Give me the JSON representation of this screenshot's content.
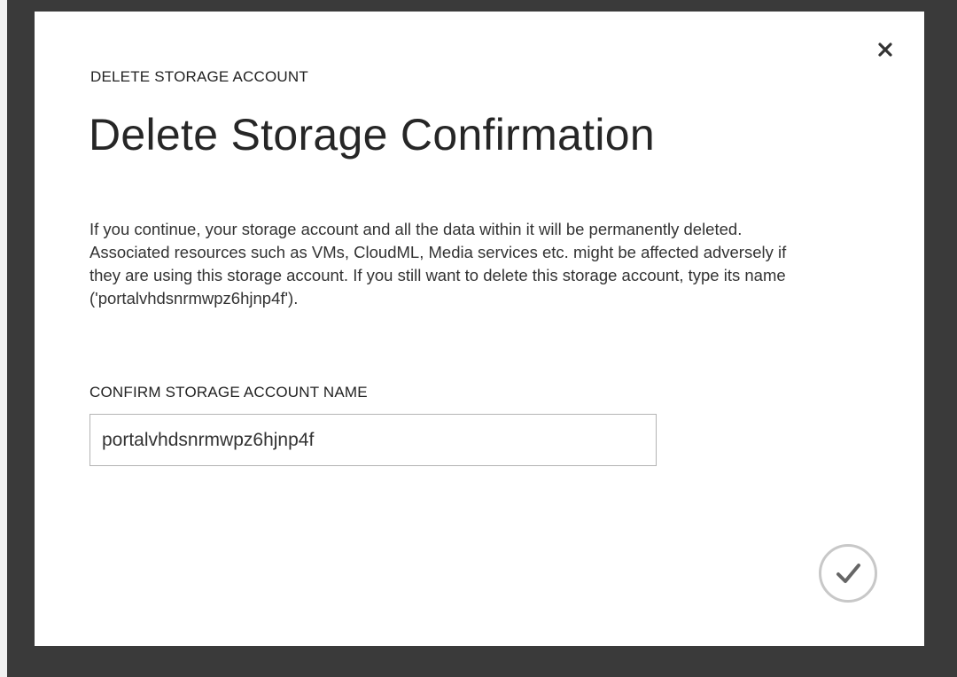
{
  "dialog": {
    "eyebrow": "DELETE STORAGE ACCOUNT",
    "title": "Delete Storage Confirmation",
    "description": "If you continue, your storage account and all the data within it will be permanently deleted. Associated resources such as VMs, CloudML, Media services etc. might be affected adversely if they are using this storage account. If you still want to delete this storage account, type its name ('portalvhdsnrmwpz6hjnp4f').",
    "field_label": "CONFIRM STORAGE ACCOUNT NAME",
    "field_value": "portalvhdsnrmwpz6hjnp4f",
    "close_icon": "close-icon",
    "confirm_icon": "checkmark-circle-icon"
  },
  "colors": {
    "backdrop": "#3a3a3a",
    "dialog_bg": "#ffffff",
    "text": "#333333",
    "input_border": "#b4b4b4",
    "confirm_ring": "#c8c8c8",
    "confirm_check": "#666666"
  }
}
